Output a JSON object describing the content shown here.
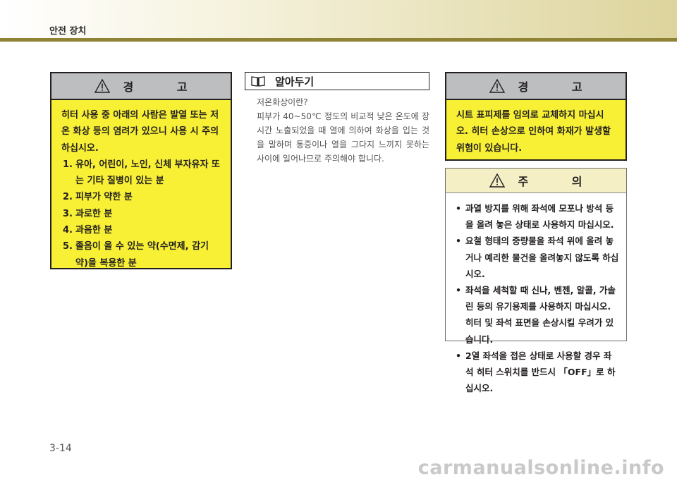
{
  "header": {
    "title": "안전 장치"
  },
  "warning1": {
    "title": "경 고",
    "intro": "히터 사용 중 아래의 사람은 발열 또는 저온 화상 등의 염려가 있으니 사용 시 주의하십시오.",
    "items": [
      {
        "num": "1.",
        "text": "유아, 어린이, 노인, 신체 부자유자 또는 기타 질병이 있는 분"
      },
      {
        "num": "2.",
        "text": "피부가 약한 분"
      },
      {
        "num": "3.",
        "text": "과로한 분"
      },
      {
        "num": "4.",
        "text": "과음한 분"
      },
      {
        "num": "5.",
        "text": "졸음이 올 수 있는 약(수면제, 감기약)을 복용한 분"
      }
    ]
  },
  "note": {
    "title": "알아두기",
    "question": "저온화상이란?",
    "text": "피부가 40~50℃ 정도의 비교적 낮은 온도에 장시간 노출되었을 때 열에 의하여 화상을 입는 것을 말하며 통증이나 열을 그다지 느끼지 못하는 사이에 일어나므로 주의해야 합니다."
  },
  "warning2": {
    "title": "경 고",
    "text": "시트 표피제를 임의로 교체하지 마십시오. 히터 손상으로 인하여 화재가 발생할 위험이 있습니다."
  },
  "caution": {
    "title": "주 의",
    "items": [
      "과열 방지를 위해 좌석에 모포나 방석 등을 올려 놓은 상태로 사용하지 마십시오.",
      "요철 형태의 중량물을 좌석 위에 올려 놓거나 예리한 물건을 올려놓지 않도록 하십시오.",
      "좌석을 세척할 때 신나, 벤젠, 알콜, 가솔린 등의 유기용제를 사용하지 마십시오. 히터 및 좌석 표면을 손상시킬 우려가 있습니다.",
      "2열 좌석을 접은 상태로 사용할 경우 좌석 히터 스위치를 반드시 「OFF」로 하십시오."
    ]
  },
  "footer": {
    "page": "3-14",
    "watermark": "carmanualsonline.info"
  },
  "icons": {
    "warning": "warning-triangle-icon",
    "note": "open-book-icon"
  },
  "colors": {
    "warning_bg": "#f7f035",
    "caution_head": "#f4efc4",
    "header_bar": "#8f8336"
  }
}
